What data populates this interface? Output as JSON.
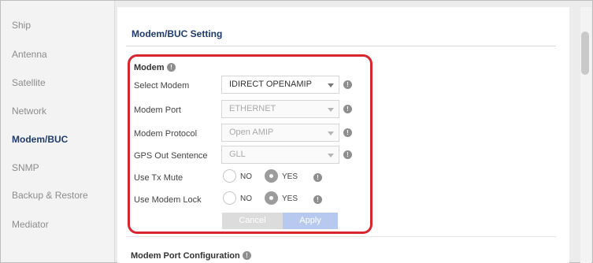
{
  "sidebar": {
    "items": [
      {
        "label": "Ship"
      },
      {
        "label": "Antenna"
      },
      {
        "label": "Satellite"
      },
      {
        "label": "Network"
      },
      {
        "label": "Modem/BUC",
        "active": true
      },
      {
        "label": "SNMP"
      },
      {
        "label": "Backup & Restore"
      },
      {
        "label": "Mediator"
      }
    ]
  },
  "page": {
    "title": "Modem/BUC Setting",
    "modem_section_title": "Modem",
    "port_section_title": "Modem Port Configuration"
  },
  "form": {
    "select_modem": {
      "label": "Select Modem",
      "value": "IDIRECT OPENAMIP",
      "enabled": true
    },
    "modem_port": {
      "label": "Modem Port",
      "value": "ETHERNET",
      "enabled": false
    },
    "modem_protocol": {
      "label": "Modem Protocol",
      "value": "Open AMIP",
      "enabled": false
    },
    "gps_out_sentence": {
      "label": "GPS Out Sentence",
      "value": "GLL",
      "enabled": false
    },
    "use_tx_mute": {
      "label": "Use Tx Mute",
      "no_label": "NO",
      "yes_label": "YES",
      "selected": "YES"
    },
    "use_modem_lock": {
      "label": "Use Modem Lock",
      "no_label": "NO",
      "yes_label": "YES",
      "selected": "YES"
    },
    "cancel_label": "Cancel",
    "apply_label": "Apply"
  },
  "icons": {
    "info": "info-icon",
    "dropdown": "chevron-down-icon"
  },
  "colors": {
    "accent": "#1f3b6e",
    "highlight_border": "#d9262e",
    "apply_button": "#b7c9ef",
    "cancel_button": "#dcdcdc"
  }
}
